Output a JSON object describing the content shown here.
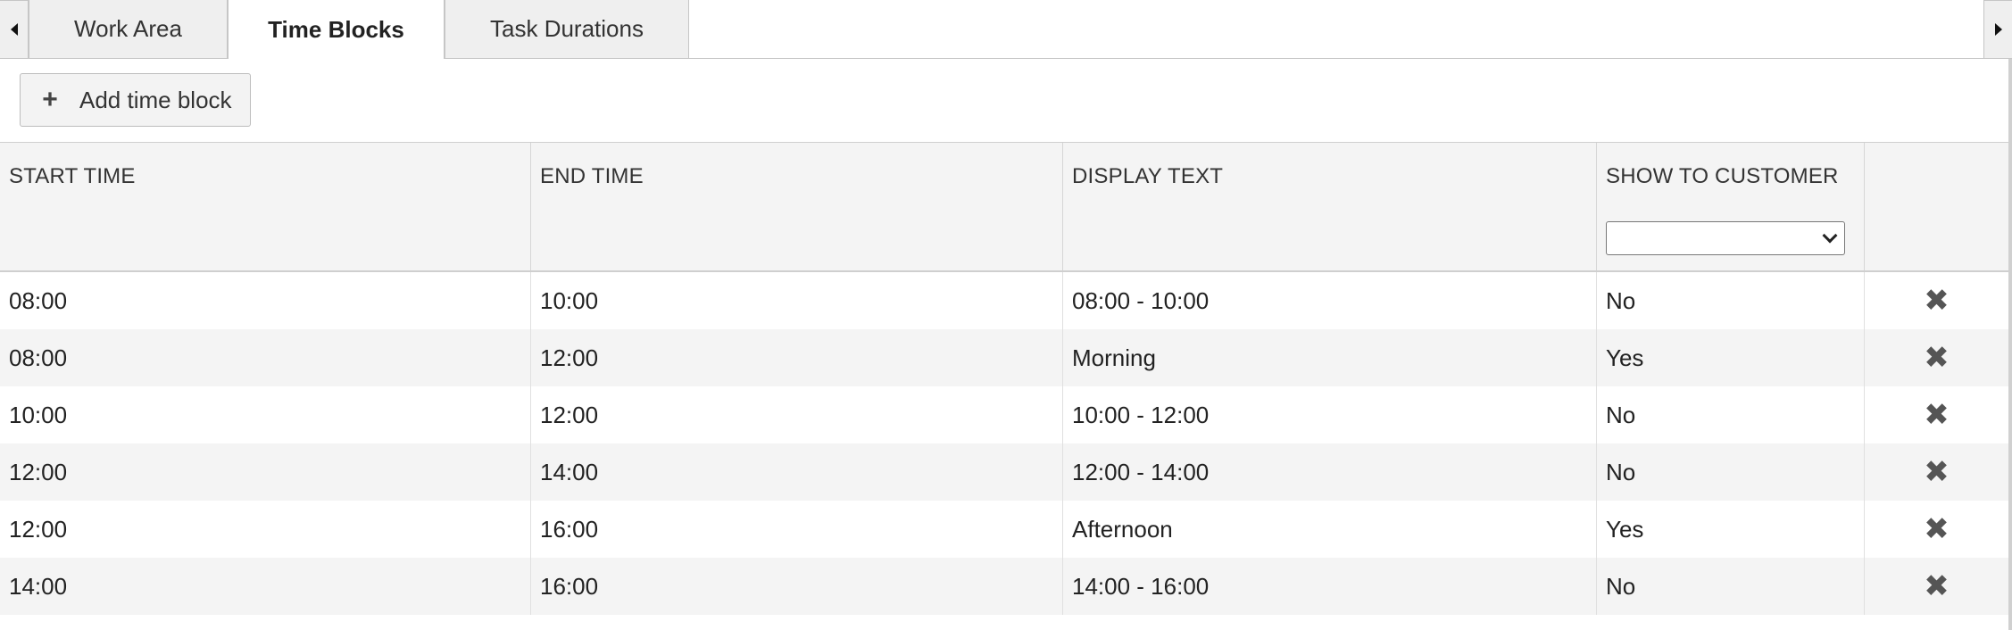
{
  "tabs": [
    {
      "label": "Work Area",
      "active": false
    },
    {
      "label": "Time Blocks",
      "active": true
    },
    {
      "label": "Task Durations",
      "active": false
    }
  ],
  "toolbar": {
    "add_label": "Add time block"
  },
  "table": {
    "columns": [
      "START TIME",
      "END TIME",
      "DISPLAY TEXT",
      "SHOW TO CUSTOMER",
      ""
    ],
    "filter": {
      "show_to_customer": ""
    },
    "rows": [
      {
        "start": "08:00",
        "end": "10:00",
        "display": "08:00 - 10:00",
        "show": "No"
      },
      {
        "start": "08:00",
        "end": "12:00",
        "display": "Morning",
        "show": "Yes"
      },
      {
        "start": "10:00",
        "end": "12:00",
        "display": "10:00 - 12:00",
        "show": "No"
      },
      {
        "start": "12:00",
        "end": "14:00",
        "display": "12:00 - 14:00",
        "show": "No"
      },
      {
        "start": "12:00",
        "end": "16:00",
        "display": "Afternoon",
        "show": "Yes"
      },
      {
        "start": "14:00",
        "end": "16:00",
        "display": "14:00 - 16:00",
        "show": "No"
      }
    ]
  },
  "icons": {
    "add": "plus-icon",
    "delete": "close-x-icon",
    "prev": "triangle-left-icon",
    "next": "triangle-right-icon"
  }
}
